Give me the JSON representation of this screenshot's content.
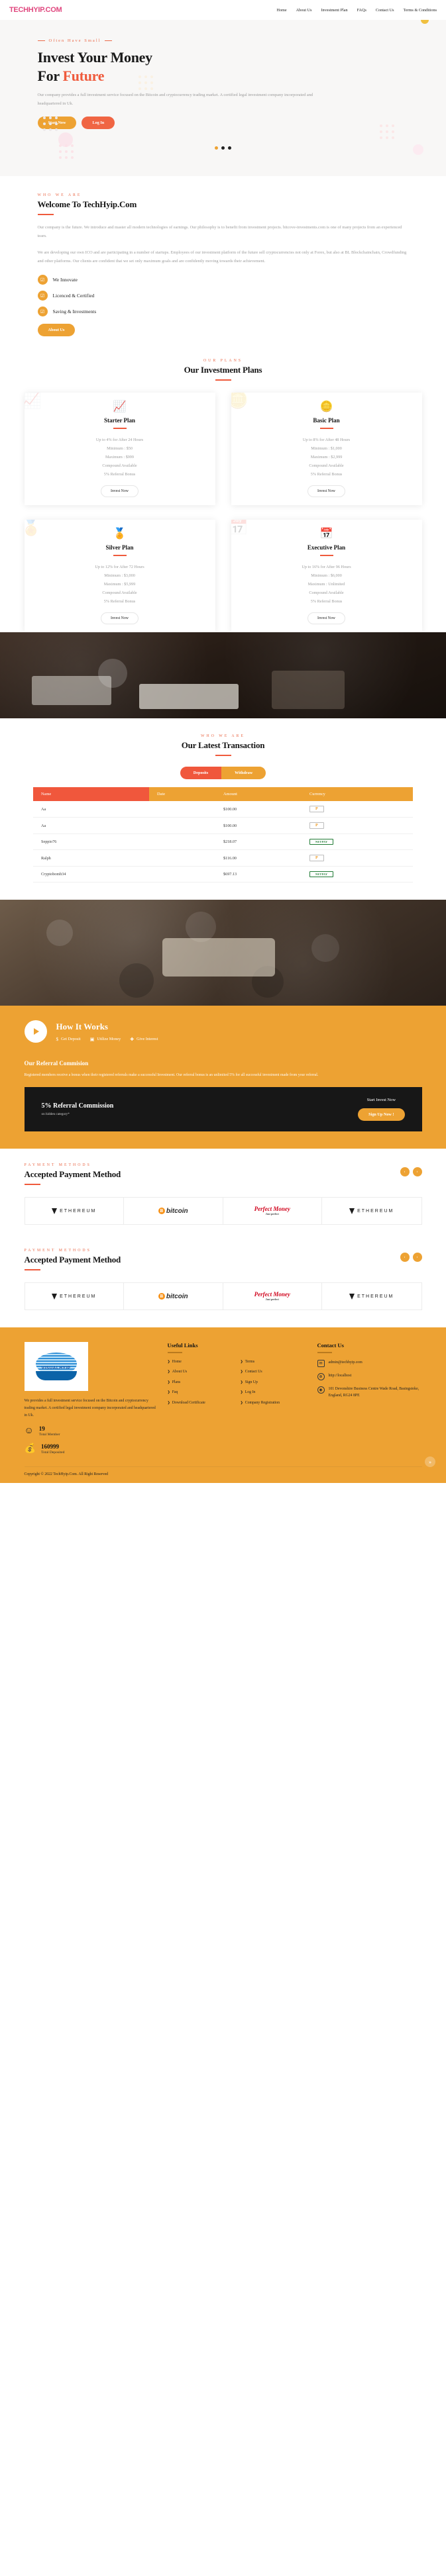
{
  "header": {
    "logo": "TECHHYIP.COM",
    "nav": [
      "Home",
      "About Us",
      "Investment Plan",
      "FAQs",
      "Contact Us",
      "Terms & Conditions"
    ]
  },
  "hero": {
    "eyebrow": "Often Have Small",
    "title_line1": "Invest Your Money",
    "title_line2_pre": "For ",
    "title_line2_accent": "Future",
    "paragraph": "Our company provides a full investment service focused on the Bitcoin and cryptocurrency trading market. A certified legal investment company incorporated and headquartered in Uk.",
    "btn_primary": "Start Now",
    "btn_secondary": "Log In"
  },
  "about": {
    "eyebrow": "WHO WE ARE",
    "title": "Welcome To TechHyip.Com",
    "p1": "Our company is the future. We introduce and master all modern technologies of earnings. Our philosophy is to benefit from investment projects. bitcove-investments.com is one of many projects from an experienced team.",
    "p2": "We are developing our own ICO and are participating in a number of startups. Employees of our investment platform of the future sell cryptocurrencies not only at Forex, but also at BL Blockchainchain, Crowdfunding and other platforms. Our clients are confident that we set only maximum goals and are confidently moving towards their achievement.",
    "features": [
      "We Innovate",
      "Licenced & Certified",
      "Saving & Investments"
    ],
    "button": "About Us"
  },
  "plans": {
    "eyebrow": "OUR PLANS",
    "title": "Our Investment Plans",
    "items": [
      {
        "icon": "chart-growth-icon",
        "glyph": "📈",
        "name": "Starter Plan",
        "rows": [
          "Up to 4% for After 24 Hours",
          "Minimum : $50",
          "Maximum : $999",
          "Compound Available",
          "5% Referral Bonus"
        ],
        "button": "Invest Now"
      },
      {
        "icon": "coins-stack-icon",
        "glyph": "🪙",
        "name": "Basic Plan",
        "rows": [
          "Up to 8% for After 48 Hours",
          "Minimum : $1,000",
          "Maximum : $2,999",
          "Compound Available",
          "5% Referral Bonus"
        ],
        "button": "Invest Now"
      },
      {
        "icon": "gold-bars-icon",
        "glyph": "🏅",
        "name": "Silver Plan",
        "rows": [
          "Up to 12% for After 72 Hours",
          "Minimum : $3,000",
          "Maximum : $5,999",
          "Compound Available",
          "5% Referral Bonus"
        ],
        "button": "Invest Now"
      },
      {
        "icon": "calendar-icon",
        "glyph": "📅",
        "name": "Executive Plan",
        "rows": [
          "Up to 16% for After 96 Hours",
          "Minimum : $6,000",
          "Maximum : Unlimited",
          "Compound Available",
          "5% Referral Bonus"
        ],
        "button": "Invest Now"
      }
    ]
  },
  "transactions": {
    "eyebrow": "WHO WE ARE",
    "title": "Our Latest Transaction",
    "tab_deposits": "Deposits",
    "tab_withdraw": "Withdraw",
    "columns": [
      "Name",
      "Date",
      "Amount",
      "Currency"
    ],
    "rows": [
      {
        "name": "Aa",
        "date": "",
        "amount": "$100.00",
        "currency": "payeer",
        "currency_label": "P"
      },
      {
        "name": "Aa",
        "date": "",
        "amount": "$100.00",
        "currency": "payeer",
        "currency_label": "P"
      },
      {
        "name": "Seppio76",
        "date": "",
        "amount": "$218.07",
        "currency": "netpay",
        "currency_label": "NETPAY"
      },
      {
        "name": "Ralph",
        "date": "",
        "amount": "$116.00",
        "currency": "payeer",
        "currency_label": "P"
      },
      {
        "name": "Cryptobomb34",
        "date": "",
        "amount": "$697.13",
        "currency": "netpay",
        "currency_label": "NETPAY"
      }
    ]
  },
  "how_it_works": {
    "title": "How It Works",
    "steps": [
      {
        "icon": "dollar-icon",
        "glyph": "$",
        "label": "Get Deposit"
      },
      {
        "icon": "banknote-icon",
        "glyph": "▣",
        "label": "Utilize Money"
      },
      {
        "icon": "plus-icon",
        "glyph": "✚",
        "label": "Give Interest"
      }
    ]
  },
  "referral": {
    "title": "Our Referral Commision",
    "paragraph": "Registered members receive a bonus when their registered referrals make a successful Investment. Our referral bonus is an unlimited 5% for all successful investment made from your referral.",
    "percent": "5% Referral Commission",
    "sub": "on hidden category*",
    "cta_label": "Start Invest Now",
    "cta_button": "Sign Up Now !"
  },
  "payments": {
    "eyebrow": "PAYMENT METHODS",
    "title": "Accepted Payment Method",
    "prev": "‹",
    "next": "›",
    "logos": [
      {
        "name": "ethereum-logo",
        "text": "ETHEREUM"
      },
      {
        "name": "bitcoin-logo",
        "text": "bitcoin",
        "symbol": "Ƀ"
      },
      {
        "name": "perfect-money-logo",
        "t1": "Perfect Money",
        "t2": "Just perfect"
      },
      {
        "name": "ethereum-logo",
        "text": "ETHEREUM"
      }
    ]
  },
  "footer": {
    "brand": "VISUALHYIP",
    "description": "We provides a full investment service focused on the Bitcoin and cryptocurrency trading market. A certified legal investment company incorporated and headquartered in Uk.",
    "stats": [
      {
        "icon": "user-icon",
        "glyph": "☺",
        "number": "19",
        "label": "Total Member"
      },
      {
        "icon": "money-bag-icon",
        "glyph": "💰",
        "number": "160999",
        "label": "Total Deposited"
      }
    ],
    "useful_links_title": "Useful Links",
    "links_col1": [
      "Home",
      "About Us",
      "Plans",
      "Faq",
      "Download Certificate"
    ],
    "links_col2": [
      "Terms",
      "Contact Us",
      "Sign Up",
      "Log In",
      "Company Registration"
    ],
    "contact_title": "Contact Us",
    "contact": [
      {
        "icon": "email-icon",
        "glyph": "✉",
        "text": "admin@techhyip.com"
      },
      {
        "icon": "globe-icon",
        "glyph": "⊕",
        "text": "http://localhost"
      },
      {
        "icon": "location-pin-icon",
        "glyph": "◉",
        "text": "101 Devonshire Business Centre Wade Road, Basingstoke, England, RG24 8PE"
      }
    ],
    "copyright": "Copyright © 2022  TechHyip.Com. All Right Reserved",
    "to_top": "»"
  }
}
